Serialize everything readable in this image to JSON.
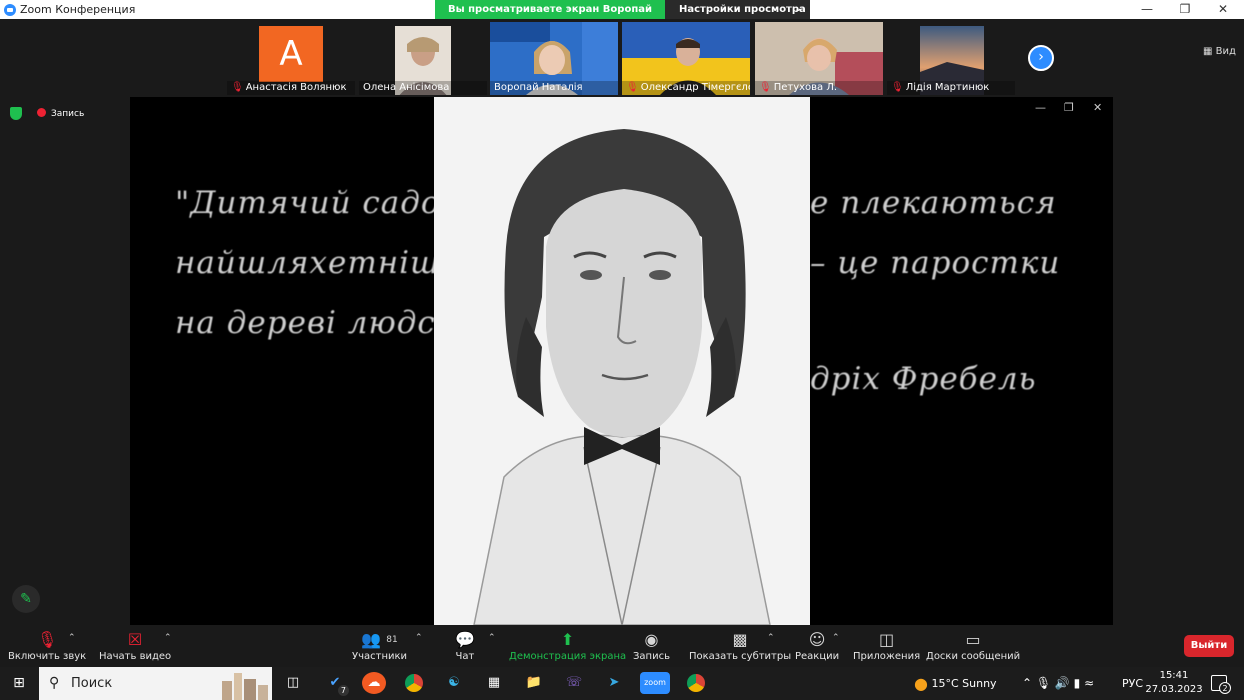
{
  "window": {
    "title": "Zoom Конференция"
  },
  "banner": {
    "sharing_text": "Вы просматриваете экран Воропай Наталія",
    "view_settings": "Настройки просмотра"
  },
  "gallery": {
    "view_label": "Вид",
    "participants": [
      {
        "name": "Анастасія Волянюк",
        "muted": true,
        "avatar_letter": "A"
      },
      {
        "name": "Олена Анісімова",
        "muted": false
      },
      {
        "name": "Воропай Наталія",
        "muted": false
      },
      {
        "name": "Олександр Тімергєлєєв",
        "muted": true
      },
      {
        "name": "Петухова Л.",
        "muted": true
      },
      {
        "name": "Лідія Мартинюк",
        "muted": true
      }
    ]
  },
  "recording": {
    "label": "Запись"
  },
  "shared_content": {
    "quote_lines": [
      "\"Дитячий садок",
      "найшляхетніші р",
      "на дереві людств"
    ],
    "quote_lines_right": [
      "е плекаються",
      "– це паростки",
      "дріх Фребель"
    ]
  },
  "toolbar": {
    "unmute": "Включить звук",
    "start_video": "Начать видео",
    "participants": "Участники",
    "participants_count": "81",
    "chat": "Чат",
    "share_screen": "Демонстрация экрана",
    "record": "Запись",
    "captions": "Показать субтитры",
    "reactions": "Реакции",
    "apps": "Приложения",
    "whiteboards": "Доски сообщений",
    "leave": "Выйти"
  },
  "taskbar": {
    "search_placeholder": "Поиск",
    "todo_badge": "7",
    "weather": "15°C  Sunny",
    "language": "РУС",
    "time": "15:41",
    "date": "27.03.2023",
    "notifications": "2"
  },
  "colors": {
    "accent": "#2d8cff",
    "green": "#1fc04f",
    "leave": "#d9262c",
    "avatar_orange": "#f26722"
  }
}
